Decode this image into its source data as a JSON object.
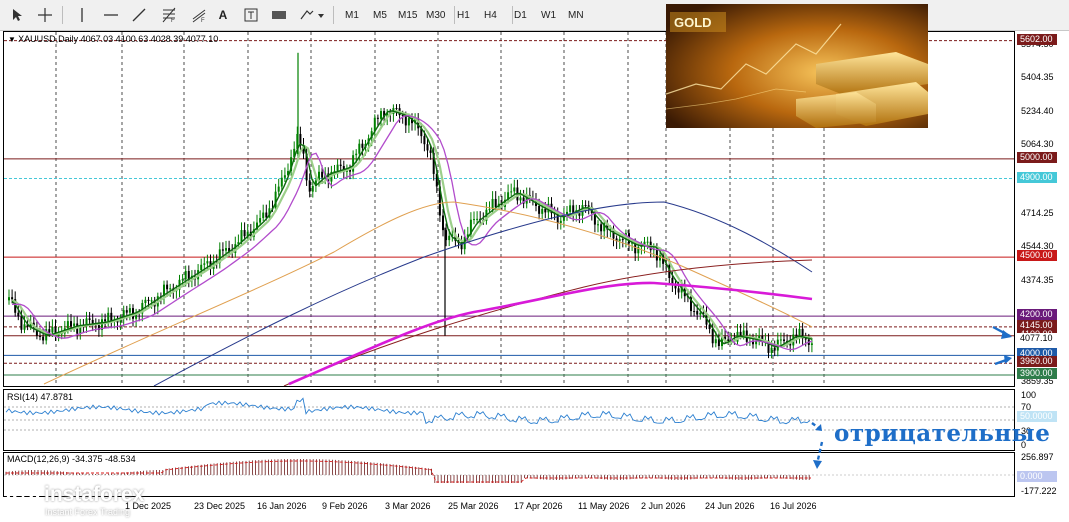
{
  "toolbar": {
    "tools": [
      "cursor-icon",
      "crosshair-icon",
      "vertical-line-icon",
      "horizontal-line-icon",
      "trendline-icon",
      "fibonacci-icon",
      "channel-icon",
      "text-label-icon",
      "text-box-icon",
      "rectangle-icon",
      "arrow-shape-icon"
    ],
    "text_tool": "A",
    "timeframes": [
      "M1",
      "M5",
      "M15",
      "M30",
      "H1",
      "H4",
      "D1",
      "W1",
      "MN"
    ]
  },
  "chart": {
    "symbol_info": "XAUUSD,Daily  4067.03 4100.63 4028.39 4077.10",
    "price_scale": [
      "5574.50",
      "5404.35",
      "5234.40",
      "5064.30",
      "4714.25",
      "4544.30",
      "4374.35",
      "3859.35"
    ],
    "levels": [
      {
        "label": "5602.00",
        "value": 5602,
        "color": "#7b1b1b"
      },
      {
        "label": "5000.00",
        "value": 5000,
        "color": "#7b1b1b"
      },
      {
        "label": "4900.00",
        "value": 4900,
        "color": "#45c8d8"
      },
      {
        "label": "4500.00",
        "value": 4500,
        "color": "#c81818"
      },
      {
        "label": "4200.00",
        "value": 4200,
        "color": "#6a1a7a"
      },
      {
        "label": "4145.00",
        "value": 4145,
        "color": "#7b1b1b"
      },
      {
        "label": "4100.00",
        "value": 4100,
        "color": "#7b1b1b"
      },
      {
        "label": "4077.10",
        "value": 4077.1,
        "color": "#111111"
      },
      {
        "label": "4000.00",
        "value": 4000,
        "color": "#1e5aa8"
      },
      {
        "label": "3960.00",
        "value": 3960,
        "color": "#7b1b1b"
      },
      {
        "label": "3900.00",
        "value": 3900,
        "color": "#2e7d4a"
      }
    ],
    "image_caption": "GOLD"
  },
  "rsi": {
    "label": "RSI(14) 47.8781",
    "scale": [
      "100",
      "70",
      "30",
      "0"
    ],
    "level_tag": "50.0000"
  },
  "macd": {
    "label": "MACD(12,26,9) -34.375 -48.534",
    "scale": [
      "256.897",
      "-177.222"
    ],
    "level_tag": "0.000"
  },
  "annotation": {
    "text": "отрицательные"
  },
  "x_axis": [
    "1 Dec 2025",
    "23 Dec 2025",
    "16 Jan 2026",
    "9 Feb 2026",
    "3 Mar 2026",
    "25 Mar 2026",
    "17 Apr 2026",
    "11 May 2026",
    "2 Jun 2026",
    "24 Jun 2026",
    "16 Jul 2026"
  ],
  "logo": {
    "name": "instaforex",
    "tagline": "Instant Forex Trading"
  },
  "colors": {
    "bull": "#008000",
    "bear": "#000000",
    "ma_dark_green": "#0d6b0d",
    "ma_light_green": "#9ccf8a",
    "ma_violet": "#b24ccc",
    "ma_magenta": "#d81ad8",
    "ma_orange": "#e0a050",
    "ma_navy": "#283a8c",
    "ma_brown": "#8a2020",
    "rsi_line": "#2b7fd0",
    "annotation": "#1e6ec8"
  }
}
